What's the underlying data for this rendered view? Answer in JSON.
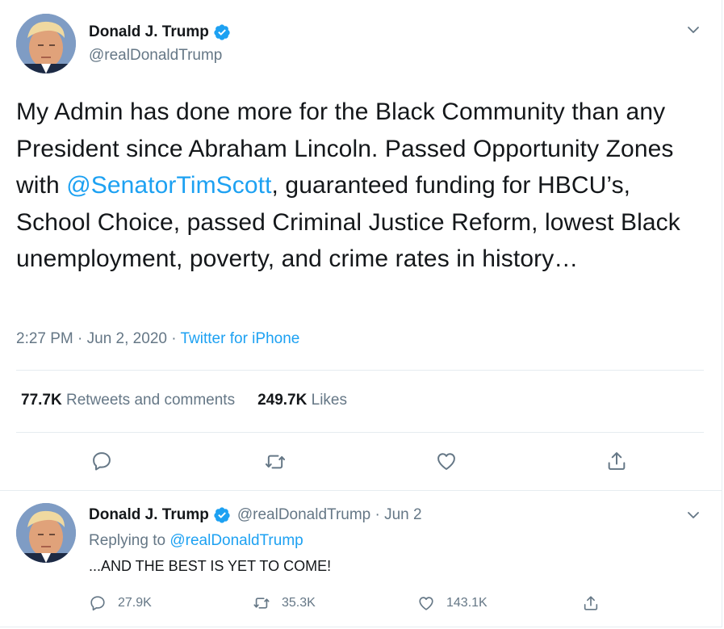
{
  "main_tweet": {
    "display_name": "Donald J. Trump",
    "handle": "@realDonaldTrump",
    "text_before_mention": "My Admin has done more for the Black Community than any President since Abraham Lincoln. Passed Opportunity Zones with ",
    "mention": "@SenatorTimScott",
    "text_after_mention": ", guaranteed funding for HBCU’s, School Choice, passed Criminal Justice Reform, lowest Black unemployment, poverty, and crime rates in history…",
    "timestamp": "2:27 PM · Jun 2, 2020 · ",
    "source": "Twitter for iPhone",
    "retweets_count": "77.7K",
    "retweets_label": "Retweets and comments",
    "likes_count": "249.7K",
    "likes_label": "Likes",
    "icons": {
      "verified": "verified-badge-icon",
      "menu": "chevron-down-icon",
      "reply": "reply-icon",
      "retweet": "retweet-icon",
      "like": "heart-icon",
      "share": "share-icon"
    }
  },
  "reply_tweet": {
    "display_name": "Donald J. Trump",
    "handle_date": "@realDonaldTrump · Jun 2",
    "replying_label": "Replying to ",
    "replying_to": "@realDonaldTrump",
    "text": "...AND THE BEST IS YET TO COME!",
    "reply_count": "27.9K",
    "retweet_count": "35.3K",
    "like_count": "143.1K"
  },
  "colors": {
    "accent": "#1da1f2",
    "secondary_text": "#657786",
    "primary_text": "#14171a",
    "divider": "#e6ecf0"
  }
}
